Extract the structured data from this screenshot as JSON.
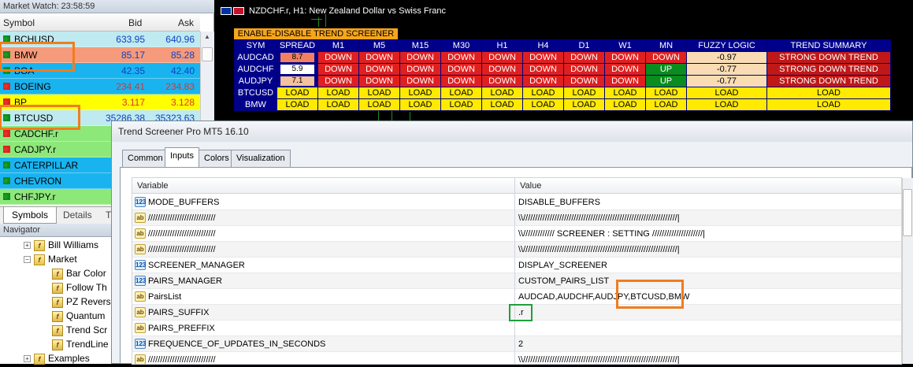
{
  "market_watch": {
    "title": "Market Watch: 23:58:59",
    "headers": {
      "symbol": "Symbol",
      "bid": "Bid",
      "ask": "Ask"
    },
    "rows": [
      {
        "symbol": "BCHUSD",
        "bid": "633.95",
        "ask": "640.96",
        "dir": "up",
        "bg": "#bfeaf0"
      },
      {
        "symbol": "BMW",
        "bid": "85.17",
        "ask": "85.28",
        "dir": "up",
        "bg": "#f59a7a"
      },
      {
        "symbol": "BOA",
        "bid": "42.35",
        "ask": "42.40",
        "dir": "up",
        "bg": "#19b4f0"
      },
      {
        "symbol": "BOEING",
        "bid": "234.41",
        "ask": "234.83",
        "dir": "down",
        "bg": "#19b4f0"
      },
      {
        "symbol": "BP",
        "bid": "3.117",
        "ask": "3.128",
        "dir": "down",
        "bg": "#ffff00"
      },
      {
        "symbol": "BTCUSD",
        "bid": "35286.38",
        "ask": "35323.63",
        "dir": "up",
        "bg": "#bfeaf0"
      },
      {
        "symbol": "CADCHF.r",
        "bid": "",
        "ask": "",
        "dir": "down",
        "bg": "#8de87a"
      },
      {
        "symbol": "CADJPY.r",
        "bid": "",
        "ask": "",
        "dir": "down",
        "bg": "#8de87a"
      },
      {
        "symbol": "CATERPILLAR",
        "bid": "",
        "ask": "",
        "dir": "up",
        "bg": "#19b4f0"
      },
      {
        "symbol": "CHEVRON",
        "bid": "",
        "ask": "",
        "dir": "up",
        "bg": "#19b4f0"
      },
      {
        "symbol": "CHFJPY.r",
        "bid": "",
        "ask": "",
        "dir": "up",
        "bg": "#8de87a"
      }
    ],
    "tabs": [
      "Symbols",
      "Details",
      "T"
    ]
  },
  "navigator": {
    "title": "Navigator",
    "items": [
      {
        "label": "Bill Williams",
        "level": 1,
        "kind": "folder"
      },
      {
        "label": "Market",
        "level": 1,
        "kind": "folder"
      },
      {
        "label": "Bar Color",
        "level": 2,
        "kind": "ind"
      },
      {
        "label": "Follow Th",
        "level": 2,
        "kind": "ind"
      },
      {
        "label": "PZ Revers",
        "level": 2,
        "kind": "ind"
      },
      {
        "label": "Quantum",
        "level": 2,
        "kind": "ind"
      },
      {
        "label": "Trend Scr",
        "level": 2,
        "kind": "ind"
      },
      {
        "label": "TrendLine",
        "level": 2,
        "kind": "ind"
      },
      {
        "label": "Examples",
        "level": 1,
        "kind": "folder"
      }
    ]
  },
  "chart": {
    "title": "NZDCHF.r, H1:  New Zealand Dollar vs Swiss Franc",
    "toggle_button": "ENABLE-DISABLE TREND SCREENER"
  },
  "screener": {
    "headers": [
      "SYM",
      "SPREAD",
      "M1",
      "M5",
      "M15",
      "M30",
      "H1",
      "H4",
      "D1",
      "W1",
      "MN",
      "FUZZY LOGIC",
      "TREND SUMMARY"
    ],
    "rows": [
      {
        "sym": "AUDCAD",
        "spread": "8.7",
        "spread_bg": "#f08060",
        "tf": [
          "DOWN",
          "DOWN",
          "DOWN",
          "DOWN",
          "DOWN",
          "DOWN",
          "DOWN",
          "DOWN",
          "DOWN"
        ],
        "fuzzy": "-0.97",
        "summary": "STRONG DOWN TREND"
      },
      {
        "sym": "AUDCHF",
        "spread": "5.9",
        "spread_bg": "#ffffff",
        "tf": [
          "DOWN",
          "DOWN",
          "DOWN",
          "DOWN",
          "DOWN",
          "DOWN",
          "DOWN",
          "DOWN",
          "UP"
        ],
        "fuzzy": "-0.77",
        "summary": "STRONG DOWN TREND"
      },
      {
        "sym": "AUDJPY",
        "spread": "7.1",
        "spread_bg": "#f4c29c",
        "tf": [
          "DOWN",
          "DOWN",
          "DOWN",
          "DOWN",
          "DOWN",
          "DOWN",
          "DOWN",
          "DOWN",
          "UP"
        ],
        "fuzzy": "-0.77",
        "summary": "STRONG DOWN TREND"
      },
      {
        "sym": "BTCUSD",
        "spread": "LOAD",
        "spread_bg": "",
        "tf": [
          "LOAD",
          "LOAD",
          "LOAD",
          "LOAD",
          "LOAD",
          "LOAD",
          "LOAD",
          "LOAD",
          "LOAD"
        ],
        "fuzzy": "LOAD",
        "summary": "LOAD"
      },
      {
        "sym": "BMW",
        "spread": "LOAD",
        "spread_bg": "",
        "tf": [
          "LOAD",
          "LOAD",
          "LOAD",
          "LOAD",
          "LOAD",
          "LOAD",
          "LOAD",
          "LOAD",
          "LOAD"
        ],
        "fuzzy": "LOAD",
        "summary": "LOAD"
      }
    ]
  },
  "dialog": {
    "title": "Trend Screener Pro MT5 16.10",
    "tabs": [
      "Common",
      "Inputs",
      "Colors",
      "Visualization"
    ],
    "active_tab": "Inputs",
    "columns": {
      "variable": "Variable",
      "value": "Value"
    },
    "rows": [
      {
        "type": "123",
        "var": "MODE_BUFFERS",
        "val": "DISABLE_BUFFERS"
      },
      {
        "type": "ab",
        "var": "////////////////////////////",
        "val": "\\\\////////////////////////////////////////////////////////////////|"
      },
      {
        "type": "ab",
        "var": "////////////////////////////",
        "val": "\\\\///////////// SCREENER : SETTING /////////////////////|"
      },
      {
        "type": "ab",
        "var": "////////////////////////////",
        "val": "\\\\////////////////////////////////////////////////////////////////|"
      },
      {
        "type": "123",
        "var": "SCREENER_MANAGER",
        "val": "DISPLAY_SCREENER"
      },
      {
        "type": "123",
        "var": "PAIRS_MANAGER",
        "val": "CUSTOM_PAIRS_LIST"
      },
      {
        "type": "ab",
        "var": "PairsList",
        "val": "AUDCAD,AUDCHF,AUDJPY,BTCUSD,BMW"
      },
      {
        "type": "ab",
        "var": "PAIRS_SUFFIX",
        "val": ".r"
      },
      {
        "type": "ab",
        "var": "PAIRS_PREFFIX",
        "val": ""
      },
      {
        "type": "123",
        "var": "FREQUENCE_OF_UPDATES_IN_SECONDS",
        "val": "2"
      },
      {
        "type": "ab",
        "var": "////////////////////////////",
        "val": "\\\\////////////////////////////////////////////////////////////////|"
      }
    ]
  },
  "colors": {
    "highlight_orange": "#f07d1e",
    "highlight_green": "#1ea03c",
    "screener_blue": "#00008b",
    "down_red": "#e02020",
    "up_green": "#0a8c1e",
    "load_yellow": "#ffea00"
  }
}
